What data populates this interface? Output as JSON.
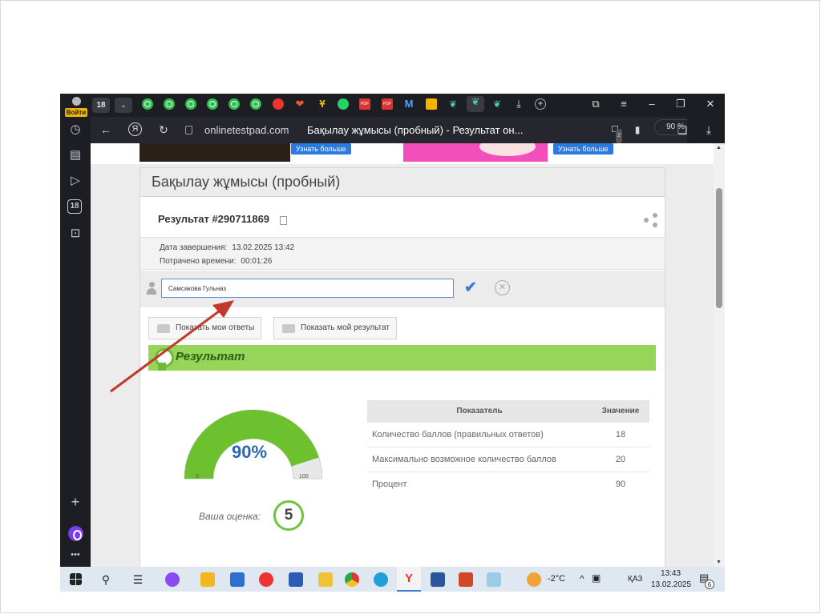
{
  "sidebar": {
    "login_label": "Войти",
    "tab_count_badge": "18"
  },
  "tabstrip": {
    "tab_count": "18"
  },
  "addressbar": {
    "yandex_icon": "Я",
    "url": "onlinetestpad.com",
    "page_title": "Бақылау жұмысы (пробный) - Результат он...",
    "tab_badge": "2",
    "zoom": "90 %"
  },
  "ads": {
    "btn1": "Узнать больше",
    "btn2": "Узнать больше"
  },
  "card": {
    "title": "Бақылау жұмысы (пробный)",
    "result_id": "Результат #290711869",
    "date_label": "Дата завершения:",
    "date_value": "13.02.2025 13:42",
    "time_label": "Потрачено времени:",
    "time_value": "00:01:26",
    "name_value": "Самсакова Гульназ",
    "show_answers": "Показать мои ответы",
    "show_result": "Показать мой результат",
    "band_title": "Результат"
  },
  "gauge": {
    "value": "90%",
    "percent": 90,
    "min": "0",
    "max": "100"
  },
  "grade": {
    "label": "Ваша оценка:",
    "value": "5"
  },
  "table": {
    "headers": [
      "Показатель",
      "Значение"
    ],
    "rows": [
      {
        "label": "Количество баллов (правильных ответов)",
        "value": "18"
      },
      {
        "label": "Максимально возможное количество баллов",
        "value": "20"
      },
      {
        "label": "Процент",
        "value": "90"
      }
    ]
  },
  "taskbar": {
    "temp": "-2°C",
    "lang": "ҚАЗ",
    "time": "13:43",
    "date": "13.02.2025",
    "notif": "6"
  },
  "colors": {
    "gauge_green": "#6ec12e",
    "band_green": "#96d45a",
    "accent_blue": "#2b66b6"
  }
}
